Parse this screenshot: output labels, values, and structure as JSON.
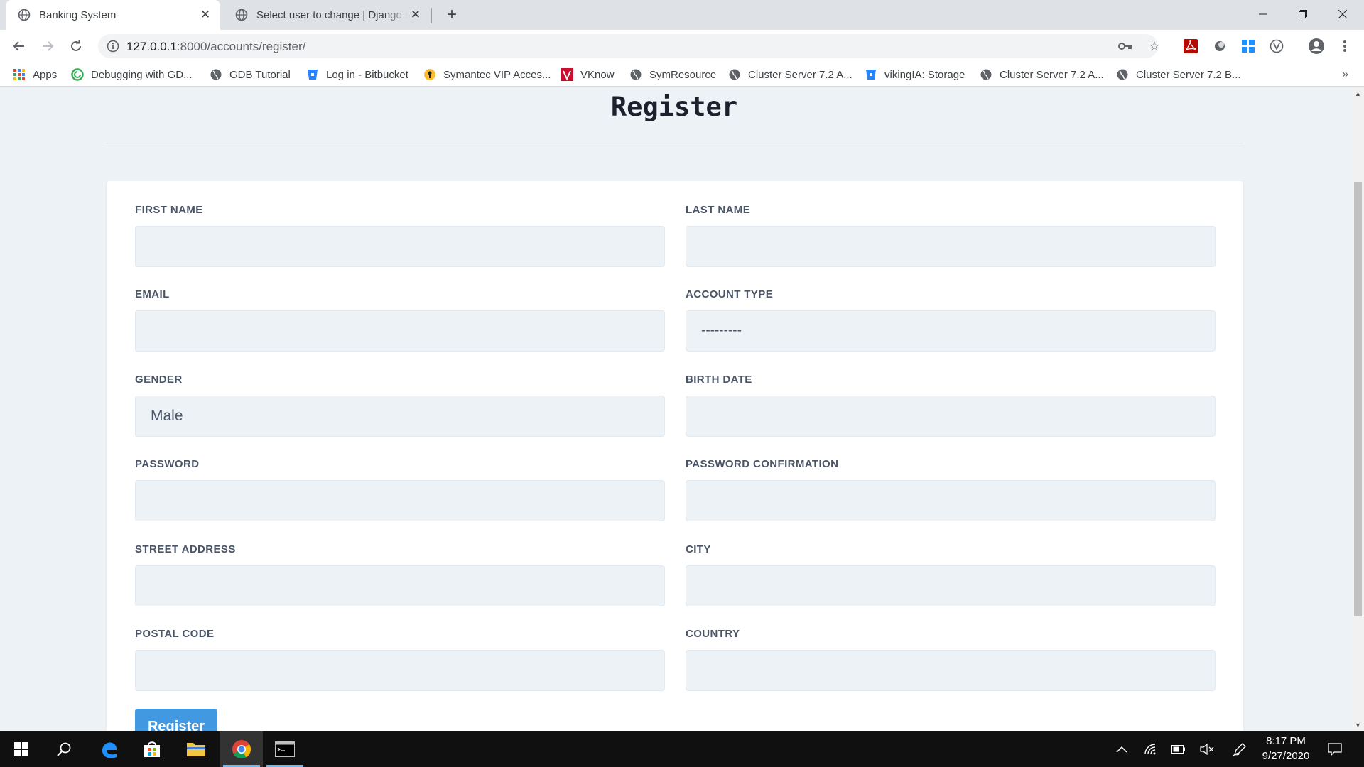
{
  "browser": {
    "tabs": [
      {
        "title": "Banking System",
        "active": true
      },
      {
        "title": "Select user to change | Django site admin",
        "active": false
      }
    ],
    "url": {
      "host": "127.0.0.1",
      "path": ":8000/accounts/register/"
    },
    "bookmarks": [
      {
        "label": "Apps",
        "icon": "apps-grid-icon"
      },
      {
        "label": "Debugging with GD...",
        "icon": "green-circle-icon"
      },
      {
        "label": "GDB Tutorial",
        "icon": "globe-icon"
      },
      {
        "label": "Log in - Bitbucket",
        "icon": "bitbucket-icon"
      },
      {
        "label": "Symantec VIP Acces...",
        "icon": "symantec-icon"
      },
      {
        "label": "VKnow",
        "icon": "vknow-icon"
      },
      {
        "label": "SymResource",
        "icon": "globe-icon"
      },
      {
        "label": "Cluster Server 7.2 A...",
        "icon": "globe-icon"
      },
      {
        "label": "vikingIA: Storage",
        "icon": "bitbucket-icon"
      },
      {
        "label": "Cluster Server 7.2 A...",
        "icon": "globe-icon"
      },
      {
        "label": "Cluster Server 7.2 B...",
        "icon": "globe-icon"
      }
    ],
    "more_bookmarks": "»"
  },
  "page": {
    "title": "Register",
    "fields": {
      "first_name": {
        "label": "FIRST NAME",
        "value": ""
      },
      "last_name": {
        "label": "LAST NAME",
        "value": ""
      },
      "email": {
        "label": "EMAIL",
        "value": ""
      },
      "account_type": {
        "label": "ACCOUNT TYPE",
        "value": "---------"
      },
      "gender": {
        "label": "GENDER",
        "value": "Male"
      },
      "birth_date": {
        "label": "BIRTH DATE",
        "value": ""
      },
      "password": {
        "label": "PASSWORD",
        "value": ""
      },
      "password_confirmation": {
        "label": "PASSWORD CONFIRMATION",
        "value": ""
      },
      "street_address": {
        "label": "STREET ADDRESS",
        "value": ""
      },
      "city": {
        "label": "CITY",
        "value": ""
      },
      "postal_code": {
        "label": "POSTAL CODE",
        "value": ""
      },
      "country": {
        "label": "COUNTRY",
        "value": ""
      }
    },
    "submit_label": "Register"
  },
  "taskbar": {
    "time": "8:17 PM",
    "date": "9/27/2020"
  },
  "colors": {
    "accent": "#4299e1",
    "input_bg": "#edf2f7",
    "page_bg": "#edf2f7",
    "taskbar": "#101010"
  }
}
